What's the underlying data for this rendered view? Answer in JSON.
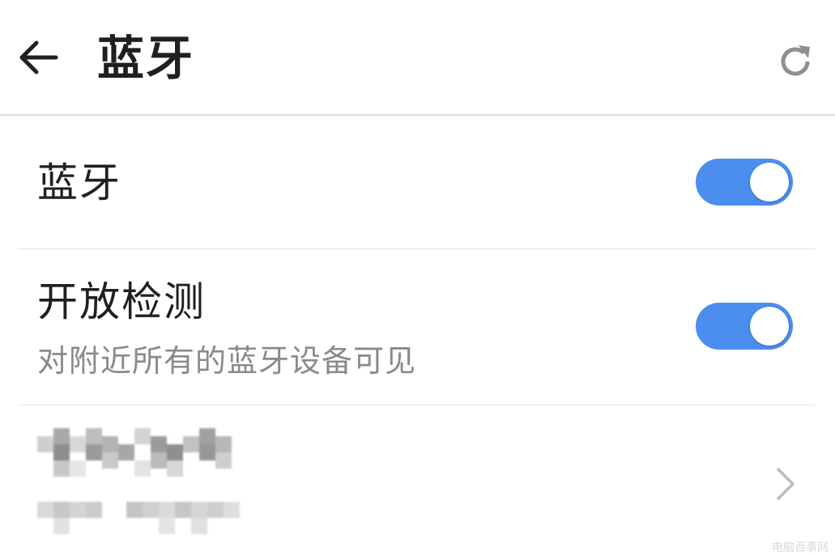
{
  "header": {
    "back_icon": "arrow-left-icon",
    "title": "蓝牙",
    "refresh_icon": "refresh-icon"
  },
  "settings": [
    {
      "label": "蓝牙",
      "toggle_on": true
    },
    {
      "label": "开放检测",
      "sublabel": "对附近所有的蓝牙设备可见",
      "toggle_on": true
    }
  ],
  "device": {
    "chevron_icon": "chevron-right-icon"
  },
  "watermark": "电脑百事网",
  "colors": {
    "accent": "#4b8ef0",
    "toggle_track_on": "#4b8ef0",
    "toggle_track_off": "#cfcfcf",
    "divider": "#e3e3e3",
    "icon": "#1f1f1f",
    "refresh_icon": "#8f8f8f",
    "chevron": "#bdbdbd",
    "secondary_text": "#8a8a8a"
  }
}
